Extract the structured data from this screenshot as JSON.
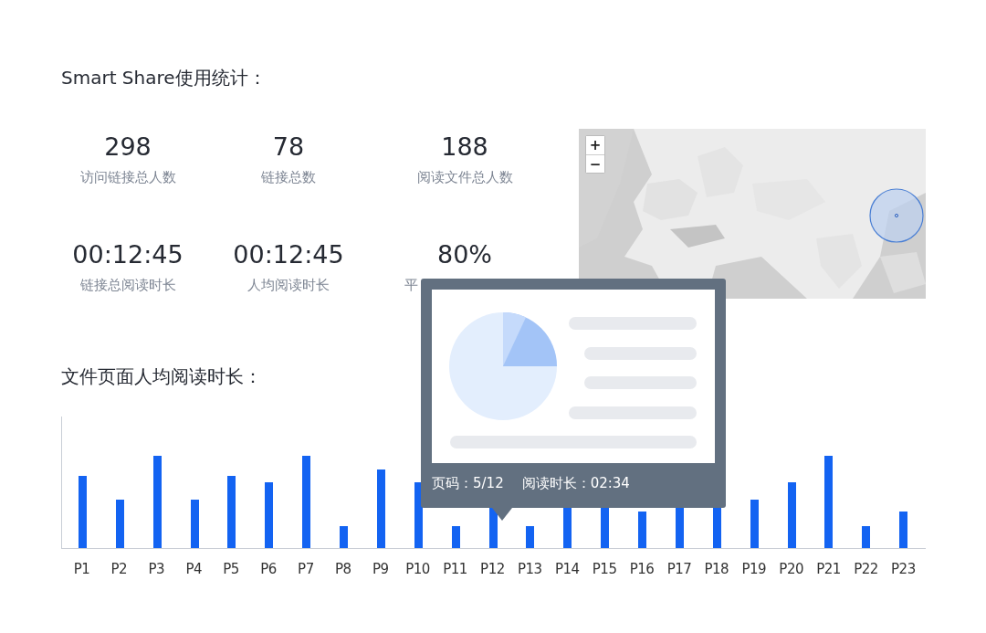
{
  "title": "Smart Share使用统计：",
  "stats": [
    {
      "value": "298",
      "label": "访问链接总人数"
    },
    {
      "value": "78",
      "label": "链接总数"
    },
    {
      "value": "188",
      "label": "阅读文件总人数"
    },
    {
      "value": "00:12:45",
      "label": "链接总阅读时长"
    },
    {
      "value": "00:12:45",
      "label": "人均阅读时长"
    },
    {
      "value": "80%",
      "label": "平"
    }
  ],
  "map": {
    "zoom_in": "+",
    "zoom_out": "−"
  },
  "chart": {
    "title": "文件页面人均阅读时长：",
    "categories": [
      "P1",
      "P2",
      "P3",
      "P4",
      "P5",
      "P6",
      "P7",
      "P8",
      "P9",
      "P10",
      "P11",
      "P12",
      "P13",
      "P14",
      "P15",
      "P16",
      "P17",
      "P18",
      "P19",
      "P20",
      "P21",
      "P22",
      "P23"
    ]
  },
  "tooltip": {
    "page": "页码：5/12",
    "duration": "阅读时长：02:34"
  }
}
